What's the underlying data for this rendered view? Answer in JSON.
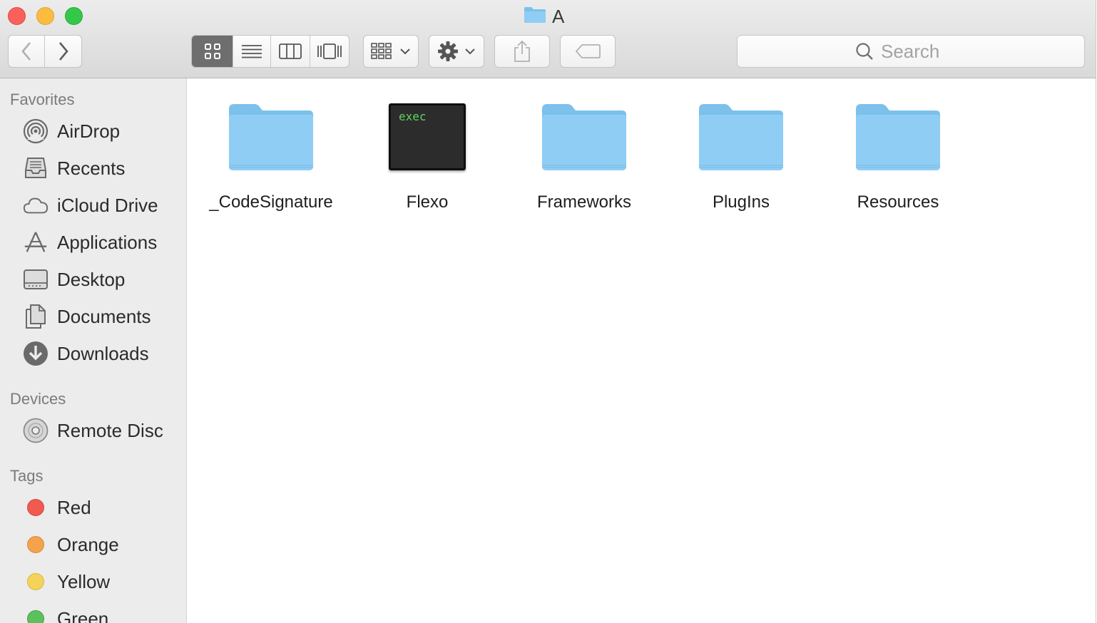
{
  "window": {
    "title": "A"
  },
  "toolbar": {
    "back_icon": "chevron-left-icon",
    "forward_icon": "chevron-right-icon",
    "view_modes": [
      "icon-view",
      "list-view",
      "column-view",
      "cover-flow-view"
    ],
    "active_view": "icon-view",
    "search": {
      "placeholder": "Search"
    }
  },
  "sidebar": {
    "favorites": {
      "header": "Favorites",
      "items": [
        {
          "label": "AirDrop",
          "icon": "airdrop-icon"
        },
        {
          "label": "Recents",
          "icon": "recents-icon"
        },
        {
          "label": "iCloud Drive",
          "icon": "cloud-icon"
        },
        {
          "label": "Applications",
          "icon": "applications-icon"
        },
        {
          "label": "Desktop",
          "icon": "desktop-icon"
        },
        {
          "label": "Documents",
          "icon": "documents-icon"
        },
        {
          "label": "Downloads",
          "icon": "downloads-icon"
        }
      ]
    },
    "devices": {
      "header": "Devices",
      "items": [
        {
          "label": "Remote Disc",
          "icon": "disc-icon"
        }
      ]
    },
    "tags": {
      "header": "Tags",
      "items": [
        {
          "label": "Red",
          "color": "#f05a50"
        },
        {
          "label": "Orange",
          "color": "#f4a34c"
        },
        {
          "label": "Yellow",
          "color": "#f5d35a"
        },
        {
          "label": "Green",
          "color": "#5cc05c"
        }
      ]
    }
  },
  "content": {
    "items": [
      {
        "name": "_CodeSignature",
        "kind": "folder"
      },
      {
        "name": "Flexo",
        "kind": "executable",
        "badge": "exec"
      },
      {
        "name": "Frameworks",
        "kind": "folder"
      },
      {
        "name": "PlugIns",
        "kind": "folder"
      },
      {
        "name": "Resources",
        "kind": "folder"
      }
    ]
  },
  "colors": {
    "folder": "#8fcdf4",
    "folder_tab": "#7cc0ec",
    "sidebar_bg": "#ececec",
    "active_segment": "#6e6e6e"
  }
}
